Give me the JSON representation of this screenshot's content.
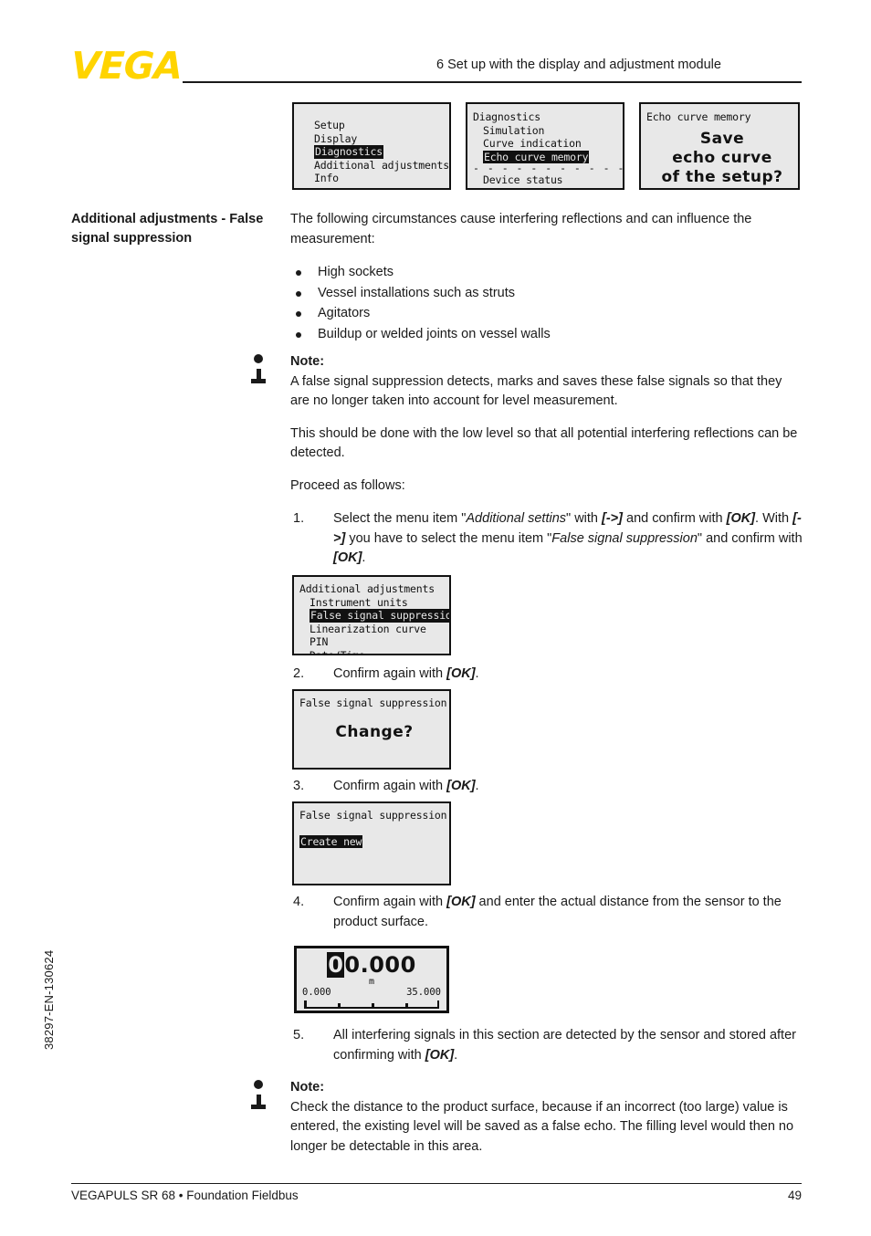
{
  "header": {
    "logo_text": "VEGA",
    "chapter_title": "6 Set up with the display and adjustment module"
  },
  "footer": {
    "left_text": "VEGAPULS SR 68 • Foundation Fieldbus",
    "page_number": "49",
    "doc_number": "38297-EN-130624"
  },
  "side_label": "Additional adjustments - False signal suppression",
  "intro": {
    "paragraph": "The following circumstances cause interfering reflections and can influence the measurement:",
    "bullets": [
      "High sockets",
      "Vessel installations such as struts",
      "Agitators",
      "Buildup or welded joints on vessel walls"
    ]
  },
  "note1": {
    "title": "Note:",
    "body": "A false signal suppression detects, marks and saves these false signals so that they are no longer taken into account for level measurement.",
    "para2": "This should be done with the low level so that all potential interfering reflections can be detected.",
    "para3": "Proceed as follows:"
  },
  "steps": {
    "s1_num": "1.",
    "s1_a": "Select the menu item \"",
    "s1_italic1": "Additional settins",
    "s1_b": "\" with ",
    "s1_bold1": "[->]",
    "s1_c": " and confirm with ",
    "s1_bold2": "[OK]",
    "s1_d": ". With ",
    "s1_bold3": "[->]",
    "s1_e": " you have to select the menu item \"",
    "s1_italic2": "False signal suppression",
    "s1_f": "\" and confirm with ",
    "s1_bold4": "[OK]",
    "s1_g": ".",
    "s2_num": "2.",
    "s2_a": "Confirm again with ",
    "s2_bold": "[OK]",
    "s2_b": ".",
    "s3_num": "3.",
    "s3_a": "Confirm again with ",
    "s3_bold": "[OK]",
    "s3_b": ".",
    "s4_num": "4.",
    "s4_a": "Confirm again with ",
    "s4_bold": "[OK]",
    "s4_b": " and enter the actual distance from the sensor to the product surface.",
    "s5_num": "5.",
    "s5_a": "All interfering signals in this section are detected by the sensor and stored after confirming with ",
    "s5_bold": "[OK]",
    "s5_b": "."
  },
  "note2": {
    "title": "Note:",
    "body": "Check the distance to the product surface, because if an incorrect (too large) value is entered, the existing level will be saved as a false echo. The filling level would then no longer be detectable in this area."
  },
  "lcd_main_menu": {
    "items": [
      "Setup",
      "Display",
      "Diagnostics",
      "Additional adjustments",
      "Info"
    ],
    "selected": "Diagnostics"
  },
  "lcd_diagnostics": {
    "title": "Diagnostics",
    "items": [
      "Simulation",
      "Curve indication",
      "Echo curve memory"
    ],
    "selected": "Echo curve memory",
    "divider": "- - - - - - - - - - - - - - - - - - - -",
    "after_divider": "Device status",
    "scroll_arrow": "▼"
  },
  "lcd_echo_save": {
    "title": "Echo curve memory",
    "line1": "Save",
    "line2": "echo curve",
    "line3": "of the setup?"
  },
  "lcd_addl_adj": {
    "title": "Additional adjustments",
    "items": [
      "Instrument units",
      "False signal suppression",
      "Linearization curve",
      "PIN",
      "Date/Time"
    ],
    "selected": "False signal suppression",
    "scroll_arrow": "▼"
  },
  "lcd_change": {
    "title": "False signal suppression",
    "prompt": "Change?"
  },
  "lcd_create_new": {
    "title": "False signal suppression",
    "selected": "Create new"
  },
  "lcd_distance": {
    "cursor_digit": "0",
    "value_rest": "0.000",
    "unit": "m",
    "scale_min": "0.000",
    "scale_max": "35.000"
  },
  "colors": {
    "brand_yellow": "#FFD400",
    "text": "#1a1a1a",
    "lcd_background": "#e8e8e8",
    "lcd_ink": "#111111"
  }
}
